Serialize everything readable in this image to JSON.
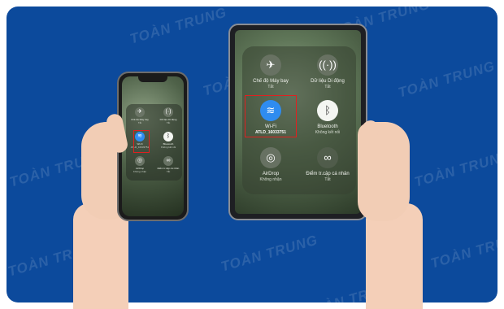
{
  "watermark": "TOÀN TRUNG",
  "colors": {
    "background": "#0c4a9c",
    "wifi_active": "#2f8cf0",
    "bluetooth_active": "#f4f6f2",
    "highlight": "#e02020"
  },
  "phone": {
    "tiles": [
      {
        "icon": "airplane-icon",
        "label": "Chế độ Máy bay",
        "sub": "Tắt"
      },
      {
        "icon": "cellular-icon",
        "label": "Dữ liệu Di động",
        "sub": "Tắt"
      },
      {
        "icon": "wifi-icon",
        "label": "Wi-Fi",
        "sub": "ATLD_16033751"
      },
      {
        "icon": "bluetooth-icon",
        "label": "Bluetooth",
        "sub": "Không kết nối"
      },
      {
        "icon": "airdrop-icon",
        "label": "AirDrop",
        "sub": "Không nhận"
      },
      {
        "icon": "hotspot-icon",
        "label": "Điểm tr.cập cá nhân",
        "sub": "Tắt"
      }
    ]
  },
  "ipad": {
    "tiles": [
      {
        "icon": "airplane-icon",
        "label": "Chế độ Máy bay",
        "sub": "Tắt"
      },
      {
        "icon": "cellular-icon",
        "label": "Dữ liệu Di động",
        "sub": "Tắt"
      },
      {
        "icon": "wifi-icon",
        "label": "Wi-Fi",
        "sub": "ATLD_16033751"
      },
      {
        "icon": "bluetooth-icon",
        "label": "Bluetooth",
        "sub": "Không kết nối"
      },
      {
        "icon": "airdrop-icon",
        "label": "AirDrop",
        "sub": "Không nhận"
      },
      {
        "icon": "hotspot-icon",
        "label": "Điểm tr.cập cá nhân",
        "sub": "Tắt"
      }
    ]
  }
}
